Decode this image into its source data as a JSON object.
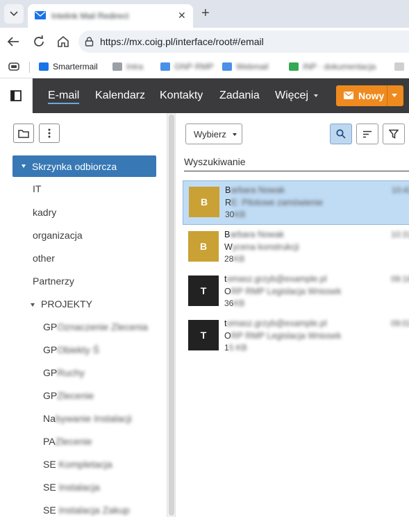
{
  "browser": {
    "tab": {
      "title": "Intelink Mail Redirect",
      "close": "✕"
    },
    "new_tab": "+",
    "url": "https://mx.coig.pl/interface/root#/email",
    "bookmarks": [
      {
        "label": "Smartermail",
        "color": "#1a73e8",
        "blurred": false
      },
      {
        "label": "Intra",
        "color": "#9aa0a6",
        "blurred": true
      },
      {
        "label": "GNP·RMP",
        "color": "#4a8fe8",
        "blurred": true
      },
      {
        "label": "Webmail",
        "color": "#4a8fe8",
        "blurred": true
      },
      {
        "label": "INP · dokumentacja",
        "color": "#34a853",
        "blurred": true
      }
    ]
  },
  "app": {
    "nav": {
      "email": "E-mail",
      "calendar": "Kalendarz",
      "contacts": "Kontakty",
      "tasks": "Zadania",
      "more": "Więcej"
    },
    "new_button": "Nowy"
  },
  "sidebar": {
    "selected_folder": "Skrzynka odbiorcza",
    "folders": [
      "IT",
      "kadry",
      "organizacja",
      "other",
      "Partnerzy"
    ],
    "projects_label": "PROJEKTY",
    "projects": [
      {
        "visible": "GP",
        "hidden": "Oznaczenie Zlecenia"
      },
      {
        "visible": "GP",
        "hidden": "Obiekty Ś"
      },
      {
        "visible": "GP",
        "hidden": "Ruchy"
      },
      {
        "visible": "GP",
        "hidden": "Zlecenie"
      },
      {
        "visible": "Na",
        "hidden": "bywanie Instalacji"
      },
      {
        "visible": "PA",
        "hidden": "Zlecenie"
      },
      {
        "visible": "SE",
        "hidden": "Kompletacja"
      },
      {
        "visible": "SE",
        "hidden": "Instalacja"
      },
      {
        "visible": "SE",
        "hidden": "Instalacja Zakup"
      }
    ]
  },
  "list": {
    "select_label": "Wybierz",
    "search_placeholder": "Wyszukiwanie",
    "messages": [
      {
        "initial": "B",
        "color": "#c9a134",
        "visible1": "B",
        "hidden1": "arbara Nowak",
        "visible2": "R",
        "hidden2": "E: Pilotowe zamówienie",
        "visible3": "30",
        "hidden3": "KB",
        "date": "10:42",
        "selected": true
      },
      {
        "initial": "B",
        "color": "#c9a134",
        "visible1": "B",
        "hidden1": "arbara Nowak",
        "visible2": "W",
        "hidden2": "ycena konstrukcji",
        "visible3": "28",
        "hidden3": "KB",
        "date": "10:31",
        "selected": false
      },
      {
        "initial": "T",
        "color": "#222222",
        "visible1": "t",
        "hidden1": "omasz.grzyb@example.pl",
        "visible2": "O",
        "hidden2": "RP RMP Legislacja Wniosek",
        "visible3": "36",
        "hidden3": "KB",
        "date": "09:18",
        "selected": false
      },
      {
        "initial": "T",
        "color": "#222222",
        "visible1": "t",
        "hidden1": "omasz.grzyb@example.pl",
        "visible2": "O",
        "hidden2": "RP RMP Legislacja Wniosek",
        "visible3": "1",
        "hidden3": "5 KB",
        "date": "09:02",
        "selected": false
      }
    ]
  }
}
